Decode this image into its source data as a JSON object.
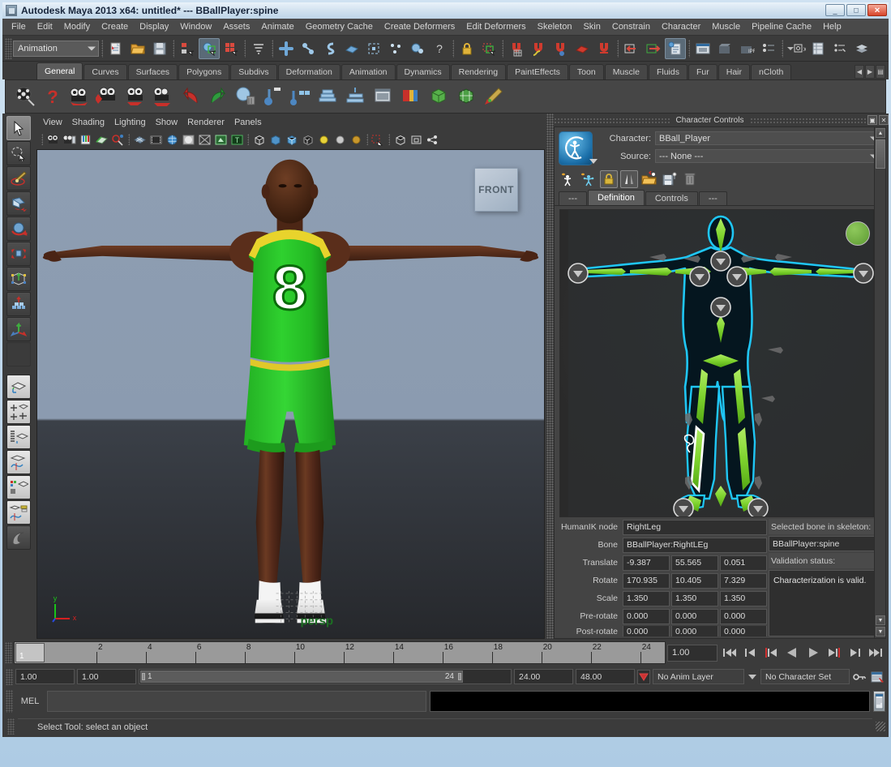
{
  "window": {
    "title": "Autodesk Maya 2013 x64: untitled*   ---   BBallPlayer:spine",
    "minimize": "_",
    "maximize": "□",
    "close": "✕"
  },
  "menubar": {
    "items": [
      "File",
      "Edit",
      "Modify",
      "Create",
      "Display",
      "Window",
      "Assets",
      "Animate",
      "Geometry Cache",
      "Create Deformers",
      "Edit Deformers",
      "Skeleton",
      "Skin",
      "Constrain",
      "Character",
      "Muscle",
      "Pipeline Cache",
      "Help"
    ]
  },
  "statusline": {
    "menuset": "Animation",
    "icons": [
      "new-scene-icon",
      "open-scene-icon",
      "save-scene-icon",
      "select-by-hierarchy-icon",
      "select-by-object-icon",
      "select-by-component-icon",
      "select-mask-icon",
      "snap-to-grid-icon",
      "snap-to-curve-icon",
      "snap-to-point-icon",
      "snap-to-plane-icon",
      "snap-to-view-plane-icon",
      "snap-to-point2-icon",
      "help-icon",
      "lock-icon",
      "highlight-selection-icon",
      "magnet-grid-icon",
      "magnet-curve-icon",
      "magnet-point-icon",
      "magnet-plane-icon",
      "magnet-view-icon",
      "input-connections-icon",
      "output-connections-icon",
      "construction-history-icon",
      "render-view-icon",
      "render-current-frame-icon",
      "ipr-render-icon",
      "render-settings-icon",
      "show-manipulator-icon",
      "exposure-icon",
      "attribute-editor-icon",
      "channel-box-icon",
      "tool-settings-icon",
      "layer-editor-icon"
    ]
  },
  "shelf": {
    "tabs": [
      "General",
      "Curves",
      "Surfaces",
      "Polygons",
      "Subdivs",
      "Deformation",
      "Animation",
      "Dynamics",
      "Rendering",
      "PaintEffects",
      "Toon",
      "Muscle",
      "Fluids",
      "Fur",
      "Hair",
      "nCloth"
    ],
    "active_tab": "General",
    "nav_prev": "◀",
    "nav_next": "▶",
    "items": [
      "film-reel-icon",
      "question-icon",
      "camera-anchor-icon",
      "camera-key-icon",
      "camera-playback-icon",
      "camera-export-icon",
      "undo-arrow-icon",
      "redo-arrow-icon",
      "sphere-delete-icon",
      "blue-key-icon",
      "set-key-icon",
      "stack-keys-icon",
      "stack-sort-icon",
      "layout-icon",
      "color-swatch-icon",
      "green-cube-icon",
      "grid-cube-icon",
      "paint-brush-icon"
    ]
  },
  "toolbox": {
    "tools": [
      "select-tool",
      "lasso-select-tool",
      "paint-select-tool",
      "move-tool",
      "rotate-tool",
      "scale-tool",
      "universal-manipulator-tool",
      "soft-modification-tool",
      "last-tool-used",
      "single-perspective-layout",
      "four-view-layout",
      "outliner-persp-layout",
      "persp-graph-layout",
      "hypershade-persp-layout",
      "persp-outliner-graph-layout",
      "maya-embedded-language-icon"
    ],
    "selected": "select-tool"
  },
  "viewport": {
    "menus": [
      "View",
      "Shading",
      "Lighting",
      "Show",
      "Renderer",
      "Panels"
    ],
    "icons": [
      "select-camera-icon",
      "camera-attributes-icon",
      "bookmark-icon",
      "image-plane-icon",
      "two-d-pan-zoom-icon",
      "grid-toggle-icon",
      "film-gate-icon",
      "resolution-gate-icon",
      "gate-mask-icon",
      "xray-icon",
      "xray-joints-icon",
      "wireframe-text-icon",
      "wireframe-shaded-icon",
      "smooth-shade-icon",
      "shaded-textured-icon",
      "wire-on-shaded-icon",
      "use-default-light-icon",
      "use-all-lights-icon",
      "shadow-icon",
      "isolate-select-icon",
      "xray-mode-icon",
      "xray-active-icon",
      "smoothness-icon"
    ],
    "orient_cube_label": "FRONT",
    "camera_label": "persp",
    "axis_x": "x",
    "axis_y": "y"
  },
  "character_controls": {
    "panel_title": "Character Controls",
    "restore_btn": "▣",
    "close_btn": "✕",
    "character_label": "Character:",
    "character_value": "BBall_Player",
    "source_label": "Source:",
    "source_value": "--- None ---",
    "toolbar_icons": [
      "create-character-definition-icon",
      "create-control-rig-icon",
      "lock-definition-icon",
      "mirror-definition-icon",
      "import-definition-icon",
      "export-definition-icon",
      "delete-definition-icon"
    ],
    "tabs": [
      "---",
      "Definition",
      "Controls",
      "---"
    ],
    "active_tab": "Definition",
    "status_dot_color": "#6eae3d",
    "fields": {
      "humanik_node_label": "HumanIK node",
      "humanik_node_value": "RightLeg",
      "bone_label": "Bone",
      "bone_value": "BBallPlayer:RightLEg",
      "translate_label": "Translate",
      "translate": [
        "-9.387",
        "55.565",
        "0.051"
      ],
      "rotate_label": "Rotate",
      "rotate": [
        "170.935",
        "10.405",
        "7.329"
      ],
      "scale_label": "Scale",
      "scale": [
        "1.350",
        "1.350",
        "1.350"
      ],
      "prerotate_label": "Pre-rotate",
      "prerotate": [
        "0.000",
        "0.000",
        "0.000"
      ],
      "postrotate_label": "Post-rotate",
      "postrotate": [
        "0.000",
        "0.000",
        "0.000"
      ],
      "selected_bone_label": "Selected bone in skeleton:",
      "selected_bone_value": "BBallPlayer:spine",
      "validation_label": "Validation status:",
      "validation_value": "Characterization is valid."
    }
  },
  "timeline": {
    "ticks": [
      "2",
      "4",
      "6",
      "8",
      "10",
      "12",
      "14",
      "16",
      "18",
      "20",
      "22",
      "24"
    ],
    "current_frame_marker": "1",
    "current_time_field": "1.00",
    "playback_buttons": [
      "go-to-start-icon",
      "step-back-frame-icon",
      "step-back-key-icon",
      "play-backwards-icon",
      "play-forwards-icon",
      "step-forward-key-icon",
      "step-forward-frame-icon",
      "go-to-end-icon"
    ]
  },
  "range": {
    "start_field": "1.00",
    "end_field": "1.00",
    "range_start": "1",
    "range_end": "24",
    "playback_end": "24.00",
    "anim_end": "48.00",
    "anim_layer": "No Anim Layer",
    "character_set": "No Character Set",
    "auto_key_icon": "auto-keyframe-icon",
    "key_icon": "key-icon",
    "prefs_icon": "animation-preferences-icon"
  },
  "command_line": {
    "mel_label": "MEL",
    "input_value": "",
    "output_value": "",
    "script_editor_icon": "script-editor-icon"
  },
  "help_line": {
    "text": "Select Tool: select an object"
  },
  "colors": {
    "maya_grey": "#3b3b3b",
    "panel_grey": "#444444",
    "accent_green": "#6eae3d",
    "hik_blue": "#1e90d4",
    "hik_green": "#7fd43c"
  }
}
